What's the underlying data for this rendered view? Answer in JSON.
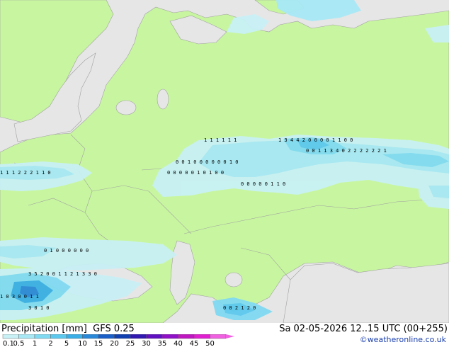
{
  "header": {
    "product": "Precipitation [mm]",
    "model": "GFS 0.25",
    "datetime": "Sa 02-05-2026 12..15 UTC (00+255)",
    "credit": "©weatheronline.co.uk"
  },
  "legend": {
    "labels": [
      "0.1",
      "0.5",
      "1",
      "2",
      "5",
      "10",
      "15",
      "20",
      "25",
      "30",
      "35",
      "40",
      "45",
      "50"
    ],
    "colors": [
      "#c8f0f5",
      "#a8e8f5",
      "#80daf2",
      "#5cc8ee",
      "#3aaee6",
      "#2a88d8",
      "#1a5ec8",
      "#1040b0",
      "#3018b0",
      "#6010c0",
      "#9010c8",
      "#c018c0",
      "#e020d0",
      "#f060e0"
    ]
  },
  "map_colors": {
    "sea": "#e6e6e6",
    "land": "#c8f6a0",
    "border": "#a0a0a0"
  },
  "grid_rows": [
    "1 1 1 1 1 1",
    "1 3 4 4 2 0 0 0 0 1 1 0 0",
    "0 0 1 1 3 4 0 2 2 2 2 2 2 1",
    "0 0 1 0 0 0 0 0 0 1 0",
    "1 1 1 2 2 2 1 1 0",
    "0 0 0 0 0 1 0 1 0 0",
    "0 0 0 0 0 1 1 0",
    "0 1 0 0 0 0 0 0",
    "3 5 2 0 0 1 1 2 1 3 3 0",
    "1 0 3 0 0 1 1",
    "3 0 1 0",
    "0 0 2 1 2 0"
  ]
}
